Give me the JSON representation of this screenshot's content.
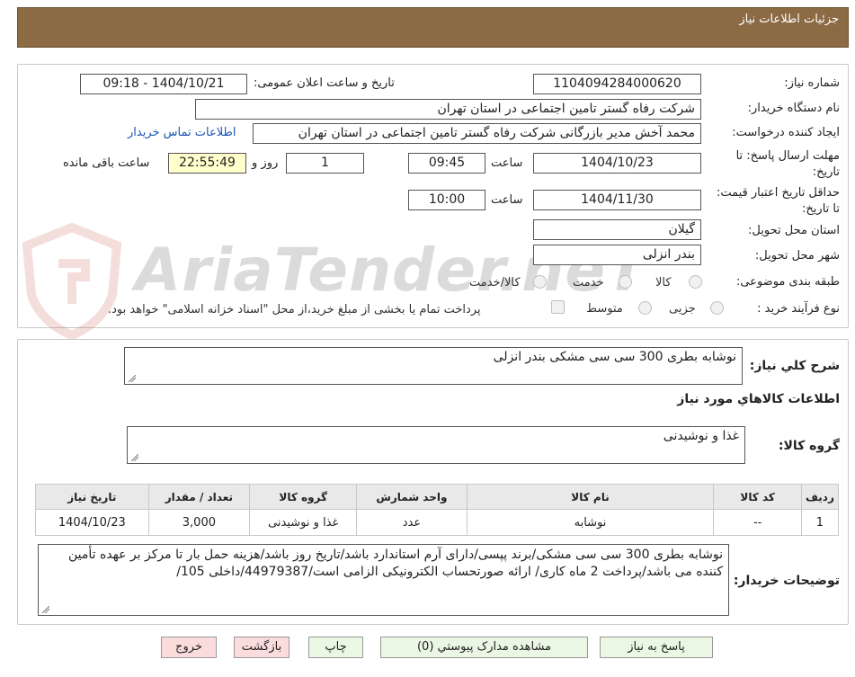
{
  "header": {
    "title": "جزئیات اطلاعات نیاز"
  },
  "fields": {
    "need_number_label": "شماره نیاز:",
    "need_number": "1104094284000620",
    "announce_label": "تاریخ و ساعت اعلان عمومی:",
    "announce_value": "1404/10/21 - 09:18",
    "buyer_org_label": "نام دستگاه خریدار:",
    "buyer_org": "شرکت رفاه گستر تامین اجتماعی در استان تهران",
    "creator_label": "ایجاد کننده درخواست:",
    "creator": "محمد آخش مدیر بازرگانی شرکت رفاه گستر تامین اجتماعی در استان تهران",
    "contact_link": "اطلاعات تماس خریدار",
    "deadline_label": "مهلت ارسال پاسخ: تا تاریخ:",
    "deadline_date": "1404/10/23",
    "time_label": "ساعت",
    "deadline_time": "09:45",
    "days_value": "1",
    "days_label": "روز و",
    "remaining_time": "22:55:49",
    "remaining_label": "ساعت باقی مانده",
    "validity_label": "حداقل تاریخ اعتبار قیمت: تا تاریخ:",
    "validity_date": "1404/11/30",
    "validity_time": "10:00",
    "province_label": "استان محل تحویل:",
    "province": "گیلان",
    "city_label": "شهر محل تحویل:",
    "city": "بندر انزلی",
    "category_label": "طبقه بندی موضوعی:",
    "category_options": [
      "کالا",
      "خدمت",
      "کالا/خدمت"
    ],
    "process_label": "نوع فرآیند خرید :",
    "process_options": [
      "جزیی",
      "متوسط"
    ],
    "payment_note": "پرداخت تمام یا بخشی از مبلغ خرید،از محل \"اسناد خزانه اسلامی\" خواهد بود."
  },
  "summary": {
    "label": "شرح کلي نياز:",
    "value": "نوشابه بطری 300 سی سی مشکی بندر انزلی"
  },
  "goods": {
    "title": "اطلاعات کالاهاي مورد نياز",
    "group_label": "گروه کالا:",
    "group_value": "غذا و نوشیدنی"
  },
  "table": {
    "headers": [
      "ردیف",
      "کد کالا",
      "نام کالا",
      "واحد شمارش",
      "گروه کالا",
      "تعداد / مقدار",
      "تاریخ نیاز"
    ],
    "rows": [
      [
        "1",
        "--",
        "نوشابه",
        "عدد",
        "غذا و نوشیدنی",
        "3,000",
        "1404/10/23"
      ]
    ]
  },
  "buyer_notes": {
    "label": "توضیحات خریدار:",
    "value": "نوشابه بطری 300 سی سی مشکی/برند پپسی/دارای آرم استاندارد باشد/تاریخ روز باشد/هزینه حمل بار تا مرکز بر عهده تأمین کننده می باشد/پرداخت 2 ماه کاری/ ارائه صورتحساب الکترونیکی الزامی است/44979387/داخلی 105/"
  },
  "buttons": {
    "reply": "پاسخ به نیاز",
    "attachments": "مشاهده مدارک پیوستي (0)",
    "print": "چاپ",
    "back": "بازگشت",
    "exit": "خروج"
  },
  "watermark": {
    "text": "AriaTender.neT"
  },
  "colors": {
    "header_bg": "#8b6a44",
    "button_green": "#eaf7e4",
    "button_pink": "#fbdcdc",
    "link": "#1a55b5"
  }
}
